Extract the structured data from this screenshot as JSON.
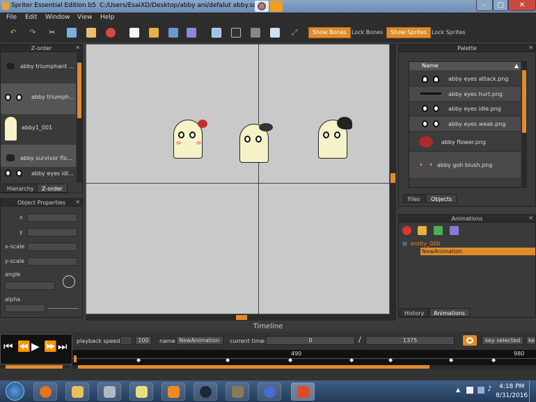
{
  "title_bar": {
    "app_title": "Spriter Essential Edition b5",
    "file_path": "C:/Users/EsaiXD/Desktop/abby ani/defalut abby.scml",
    "min": "–",
    "max": "□",
    "close": "✕"
  },
  "menu": [
    "File",
    "Edit",
    "Window",
    "View",
    "Help"
  ],
  "toolbar": {
    "show_bones": "Show Bones",
    "lock_bones": "Lock Bones",
    "show_sprites": "Show Sprites",
    "lock_sprites": "Lock Sprites"
  },
  "zorder": {
    "title": "Z-order",
    "items": [
      "abby triumphant ...",
      "abby triumph...",
      "abby1_001",
      "abby survivor flo...",
      "abby eyes idl..."
    ],
    "tabs": [
      "Hierarchy",
      "Z-order"
    ]
  },
  "object_properties": {
    "title": "Object Properties",
    "labels": [
      "x",
      "y",
      "x-scale",
      "y-scale",
      "angle",
      "alpha"
    ]
  },
  "palette": {
    "title": "Palette",
    "column": "Name",
    "items": [
      "abby eyes attack.png",
      "abby eyes hurt.png",
      "abby eyes idle.png",
      "abby eyes weak.png",
      "abby flower.png",
      "abby goh blush.png"
    ],
    "tabs": [
      "Files",
      "Objects"
    ]
  },
  "animations": {
    "title": "Animations",
    "entity": "entity_000",
    "animation": "NewAnimation",
    "tabs": [
      "History",
      "Animations"
    ]
  },
  "timeline": {
    "title": "Timeline",
    "playback_label": "playback speed",
    "speed": "100",
    "name_label": "name",
    "name_value": "NewAnimation",
    "current_time_label": "current time:",
    "current_time": "0",
    "slash": "/",
    "length": "1375",
    "key_selected": "key selected",
    "key_cut": "ke",
    "ruler": [
      "490",
      "980"
    ]
  },
  "taskbar": {
    "time": "4:18 PM",
    "date": "8/31/2016"
  },
  "colors": {
    "accent": "#e08c2c",
    "canvas": "#c9c9c9",
    "panel": "#3a3a3a"
  }
}
